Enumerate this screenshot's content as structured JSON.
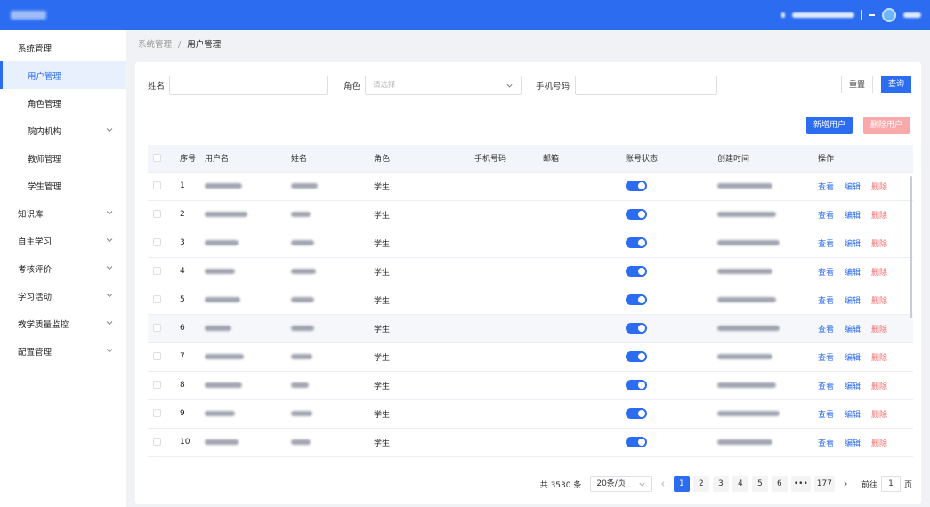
{
  "sidebar": {
    "items": [
      {
        "label": "系统管理",
        "level": "top",
        "chevron": false
      },
      {
        "label": "用户管理",
        "level": "sub",
        "active": true
      },
      {
        "label": "角色管理",
        "level": "sub"
      },
      {
        "label": "院内机构",
        "level": "sub",
        "chevron": true
      },
      {
        "label": "教师管理",
        "level": "sub"
      },
      {
        "label": "学生管理",
        "level": "sub"
      },
      {
        "label": "知识库",
        "level": "top",
        "chevron": true
      },
      {
        "label": "自主学习",
        "level": "top",
        "chevron": true
      },
      {
        "label": "考核评价",
        "level": "top",
        "chevron": true
      },
      {
        "label": "学习活动",
        "level": "top",
        "chevron": true
      },
      {
        "label": "教学质量监控",
        "level": "top",
        "chevron": true
      },
      {
        "label": "配置管理",
        "level": "top",
        "chevron": true
      }
    ]
  },
  "breadcrumb": {
    "parent": "系统管理",
    "separator": "/",
    "current": "用户管理"
  },
  "filters": {
    "name_label": "姓名",
    "role_label": "角色",
    "role_placeholder": "请选择",
    "phone_label": "手机号码",
    "reset_button": "重置",
    "search_button": "查询"
  },
  "actions": {
    "add_user": "新增用户",
    "delete_user": "删除用户"
  },
  "table": {
    "headers": [
      "序号",
      "用户名",
      "姓名",
      "角色",
      "手机号码",
      "邮箱",
      "账号状态",
      "创建时间",
      "操作"
    ],
    "row_actions": {
      "view": "查看",
      "edit": "编辑",
      "delete": "删除"
    },
    "rows": [
      {
        "no": "1",
        "role": "学生",
        "enabled": true
      },
      {
        "no": "2",
        "role": "学生",
        "enabled": true
      },
      {
        "no": "3",
        "role": "学生",
        "enabled": true
      },
      {
        "no": "4",
        "role": "学生",
        "enabled": true
      },
      {
        "no": "5",
        "role": "学生",
        "enabled": true
      },
      {
        "no": "6",
        "role": "学生",
        "enabled": true
      },
      {
        "no": "7",
        "role": "学生",
        "enabled": true
      },
      {
        "no": "8",
        "role": "学生",
        "enabled": true
      },
      {
        "no": "9",
        "role": "学生",
        "enabled": true
      },
      {
        "no": "10",
        "role": "学生",
        "enabled": true
      }
    ]
  },
  "pagination": {
    "total_text": "共 3530 条",
    "page_size": "20条/页",
    "pages": [
      "1",
      "2",
      "3",
      "4",
      "5",
      "6"
    ],
    "ellipsis": "•••",
    "last_page": "177",
    "current_page": "1",
    "goto_label": "前往",
    "goto_value": "1",
    "goto_suffix": "页"
  },
  "colors": {
    "primary": "#2c6cf0",
    "danger": "#f56c6c",
    "danger_light": "#f9a9a9"
  }
}
